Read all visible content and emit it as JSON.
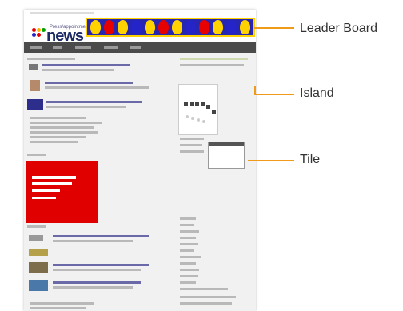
{
  "header": {
    "logo_text": "news",
    "logo_subtext": "Press/appointment"
  },
  "callouts": [
    {
      "id": "leader-board",
      "label": "Leader Board"
    },
    {
      "id": "island",
      "label": "Island"
    },
    {
      "id": "tile",
      "label": "Tile"
    }
  ],
  "ad": {
    "headline": "Keep your business running for less"
  },
  "colors": {
    "arrow": "#f09a1a",
    "leader_bg": "#2626b0",
    "leader_border": "#ffd200",
    "ad_red": "#e10000"
  },
  "leader_bulbs": [
    "#ffd200",
    "#e60000",
    "#ffd200",
    "#2424c8",
    "#ffd200",
    "#e60000",
    "#ffd200",
    "#2424c8",
    "#e60000",
    "#ffd200",
    "#2424c8",
    "#ffd200"
  ]
}
